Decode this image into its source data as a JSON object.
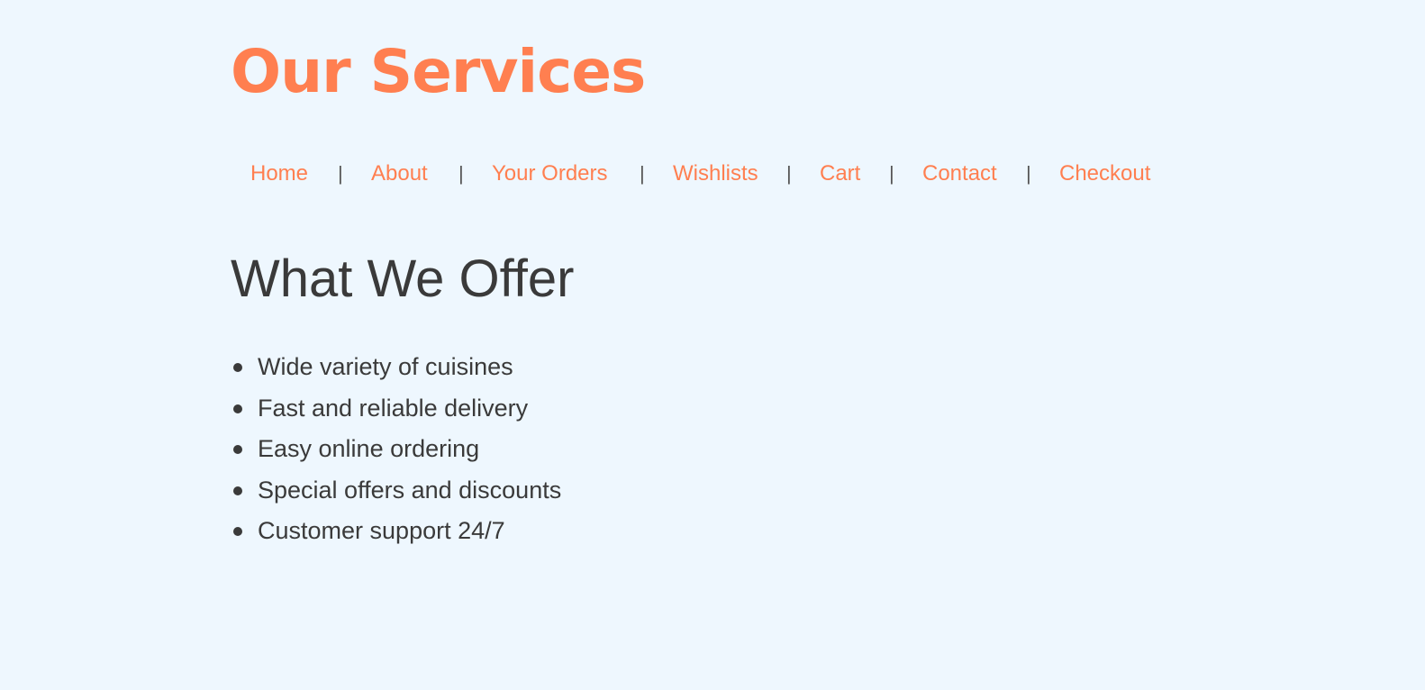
{
  "colors": {
    "background": "#eef7fe",
    "accent": "#ff7f50",
    "text": "#3a3a3a",
    "separator": "#555555"
  },
  "header": {
    "title": "Our Services"
  },
  "nav": {
    "separator": "|",
    "items": [
      {
        "label": "Home"
      },
      {
        "label": "About"
      },
      {
        "label": "Your Orders"
      },
      {
        "label": "Wishlists"
      },
      {
        "label": "Cart"
      },
      {
        "label": "Contact"
      },
      {
        "label": "Checkout"
      }
    ]
  },
  "main": {
    "heading": "What We Offer",
    "offers": [
      "Wide variety of cuisines",
      "Fast and reliable delivery",
      "Easy online ordering",
      "Special offers and discounts",
      "Customer support 24/7"
    ]
  }
}
